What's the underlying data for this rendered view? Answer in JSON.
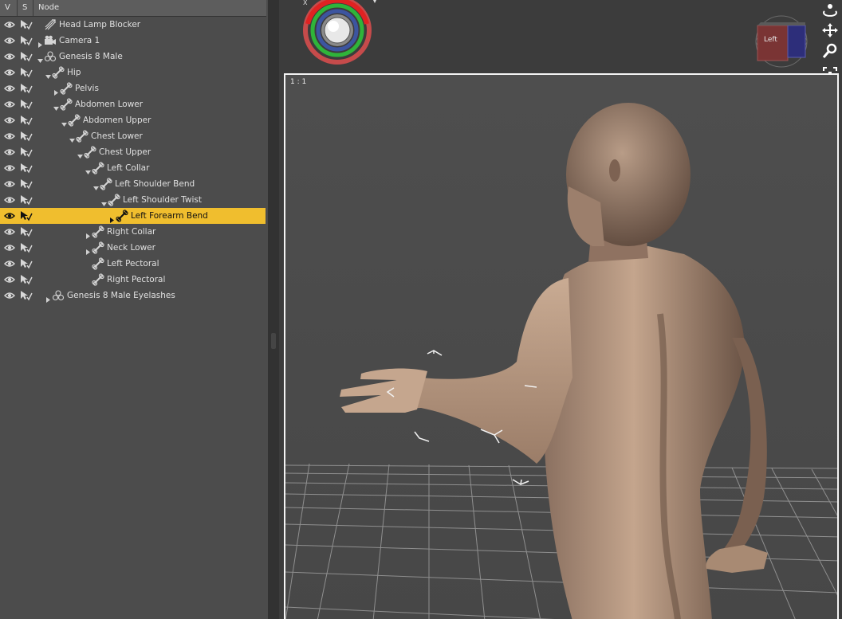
{
  "header": {
    "col_v": "V",
    "col_s": "S",
    "col_node": "Node"
  },
  "nodes": [
    {
      "label": "Head Lamp Blocker",
      "depth": 0,
      "icon": "light-icon",
      "twisty": "none",
      "selected": false
    },
    {
      "label": "Camera 1",
      "depth": 0,
      "icon": "camera-icon",
      "twisty": "collapsed",
      "selected": false
    },
    {
      "label": "Genesis 8 Male",
      "depth": 0,
      "icon": "figure-icon",
      "twisty": "expanded",
      "selected": false
    },
    {
      "label": "Hip",
      "depth": 1,
      "icon": "bone-icon",
      "twisty": "expanded",
      "selected": false
    },
    {
      "label": "Pelvis",
      "depth": 2,
      "icon": "bone-icon",
      "twisty": "collapsed",
      "selected": false
    },
    {
      "label": "Abdomen Lower",
      "depth": 2,
      "icon": "bone-icon",
      "twisty": "expanded",
      "selected": false
    },
    {
      "label": "Abdomen Upper",
      "depth": 3,
      "icon": "bone-icon",
      "twisty": "expanded",
      "selected": false
    },
    {
      "label": "Chest Lower",
      "depth": 4,
      "icon": "bone-icon",
      "twisty": "expanded",
      "selected": false
    },
    {
      "label": "Chest Upper",
      "depth": 5,
      "icon": "bone-icon",
      "twisty": "expanded",
      "selected": false
    },
    {
      "label": "Left Collar",
      "depth": 6,
      "icon": "bone-icon",
      "twisty": "expanded",
      "selected": false
    },
    {
      "label": "Left Shoulder Bend",
      "depth": 7,
      "icon": "bone-icon",
      "twisty": "expanded",
      "selected": false
    },
    {
      "label": "Left Shoulder Twist",
      "depth": 8,
      "icon": "bone-icon",
      "twisty": "expanded",
      "selected": false
    },
    {
      "label": "Left Forearm Bend",
      "depth": 9,
      "icon": "bone-icon",
      "twisty": "collapsed",
      "selected": true
    },
    {
      "label": "Right Collar",
      "depth": 6,
      "icon": "bone-icon",
      "twisty": "collapsed",
      "selected": false
    },
    {
      "label": "Neck Lower",
      "depth": 6,
      "icon": "bone-icon",
      "twisty": "collapsed",
      "selected": false
    },
    {
      "label": "Left Pectoral",
      "depth": 6,
      "icon": "bone-icon",
      "twisty": "none",
      "selected": false
    },
    {
      "label": "Right Pectoral",
      "depth": 6,
      "icon": "bone-icon",
      "twisty": "none",
      "selected": false
    },
    {
      "label": "Genesis 8 Male Eyelashes",
      "depth": 1,
      "icon": "figure-icon",
      "twisty": "collapsed",
      "selected": false
    }
  ],
  "viewport": {
    "ratio_label": "1 : 1",
    "navcube_label": "Left",
    "tools": [
      "orbit-icon",
      "pan-icon",
      "zoom-icon",
      "frame-icon",
      "reset-view-icon"
    ]
  },
  "colors": {
    "selection": "#f0be2e",
    "panel": "#4c4c4c",
    "viewport_border": "#f4f4f4"
  }
}
